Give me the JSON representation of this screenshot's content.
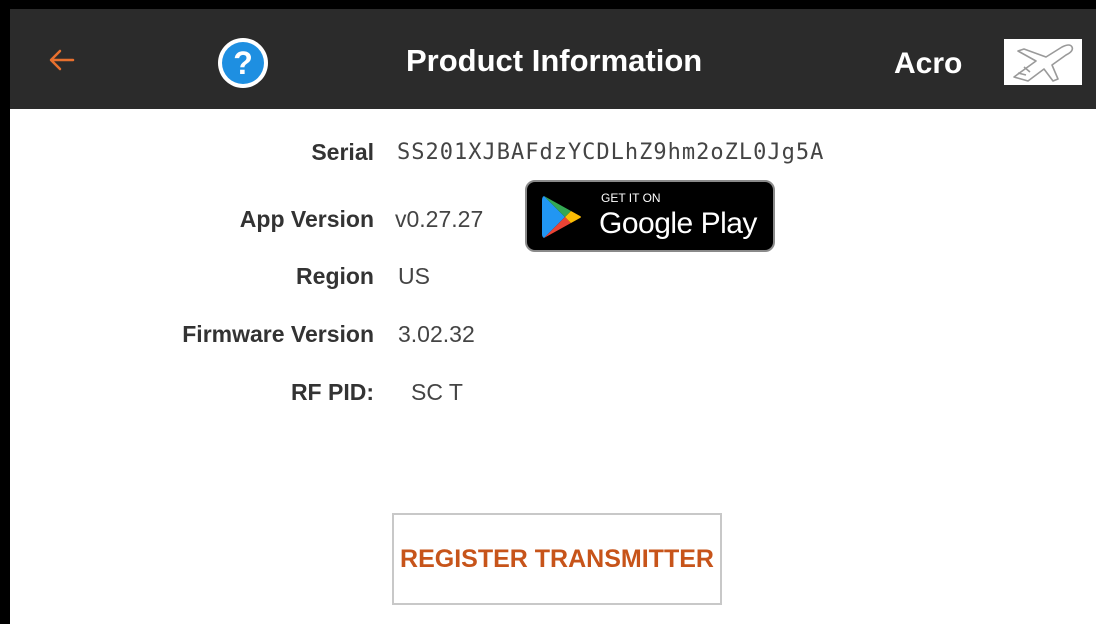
{
  "header": {
    "title": "Product Information",
    "model_name": "Acro",
    "back_icon": "arrow-left-icon",
    "help_icon": "help-circle-icon",
    "help_glyph": "?",
    "model_icon": "airplane-outline-icon",
    "accent_color": "#e8702e",
    "help_color": "#1e8fe1"
  },
  "info": {
    "serial_label": "Serial",
    "serial_value": "SS201XJBAFdzYCDLhZ9hm2oZL0Jg5A",
    "app_version_label": "App Version",
    "app_version_value": "v0.27.27",
    "region_label": "Region",
    "region_value": "US",
    "firmware_label": "Firmware Version",
    "firmware_value": "3.02.32",
    "rf_pid_label": "RF PID:",
    "rf_pid_value": "SC T"
  },
  "google_play": {
    "small_text": "GET IT ON",
    "big_text": "Google Play"
  },
  "actions": {
    "register_label": "REGISTER TRANSMITTER",
    "register_color": "#c7541a"
  }
}
